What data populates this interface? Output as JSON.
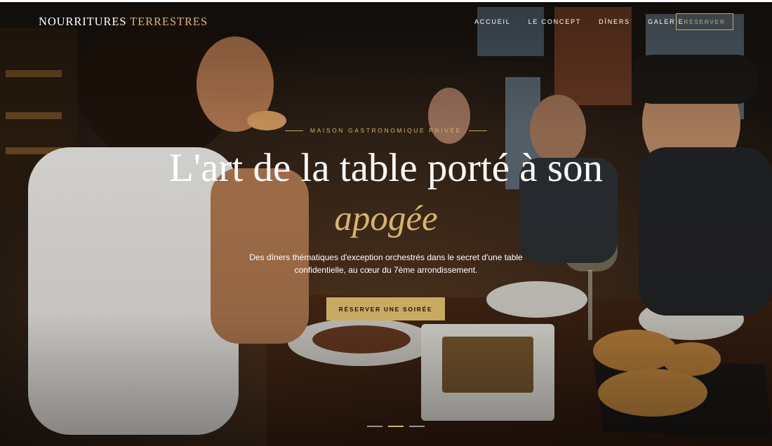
{
  "brand": {
    "word1": "NOURRITURES",
    "word2": "TERRESTRES"
  },
  "nav": {
    "items": [
      {
        "label": "ACCUEIL"
      },
      {
        "label": "LE CONCEPT"
      },
      {
        "label": "DÎNERS"
      },
      {
        "label": "GALERIE"
      }
    ],
    "cta_label": "RÉSERVER"
  },
  "hero": {
    "eyebrow": "MAISON GASTRONOMIQUE PRIVÉE",
    "headline": "L'art de la table porté à son",
    "headline_accent": "apogée",
    "subtitle_line1": "Des dîners thématiques d'exception orchestrés dans le secret d'une table",
    "subtitle_line2": "confidentielle, au cœur du 7ème arrondissement.",
    "cta_label": "RÉSERVER UNE SOIRÉE",
    "background": "photo: guests dining at a restaurant table",
    "slides": {
      "count": 3,
      "active": 2
    }
  },
  "colors": {
    "accent": "#c9aa63",
    "accent_text": "#d4b56a",
    "text": "#ffffff"
  }
}
